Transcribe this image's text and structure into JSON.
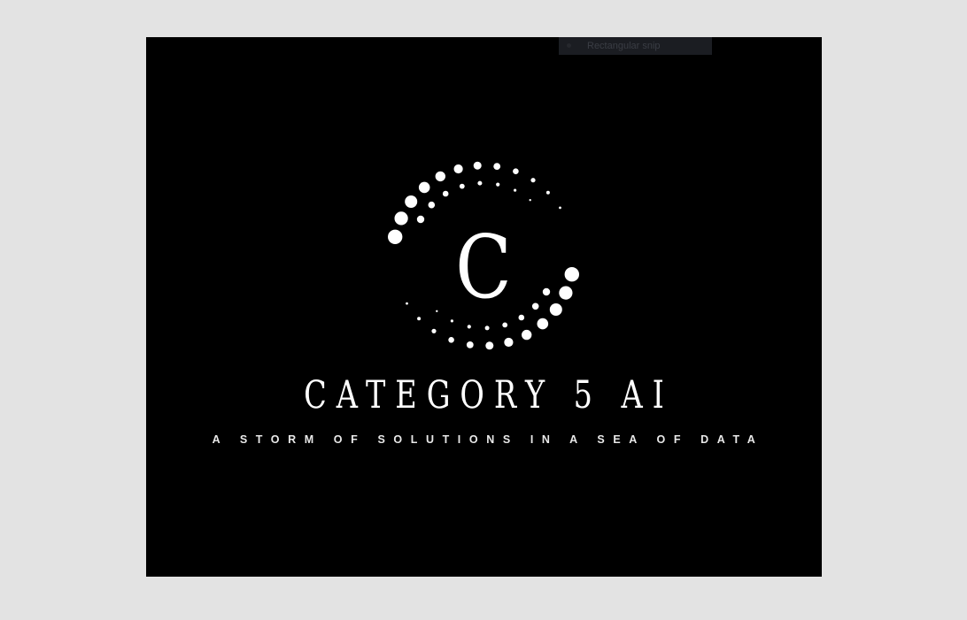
{
  "tooltip": {
    "label": "Rectangular snip"
  },
  "logo": {
    "letter": "C",
    "brand_name": "CATEGORY 5 AI",
    "tagline": "A STORM OF SOLUTIONS IN A SEA OF DATA"
  },
  "colors": {
    "background": "#e3e3e3",
    "canvas": "#000000",
    "foreground": "#ffffff"
  }
}
